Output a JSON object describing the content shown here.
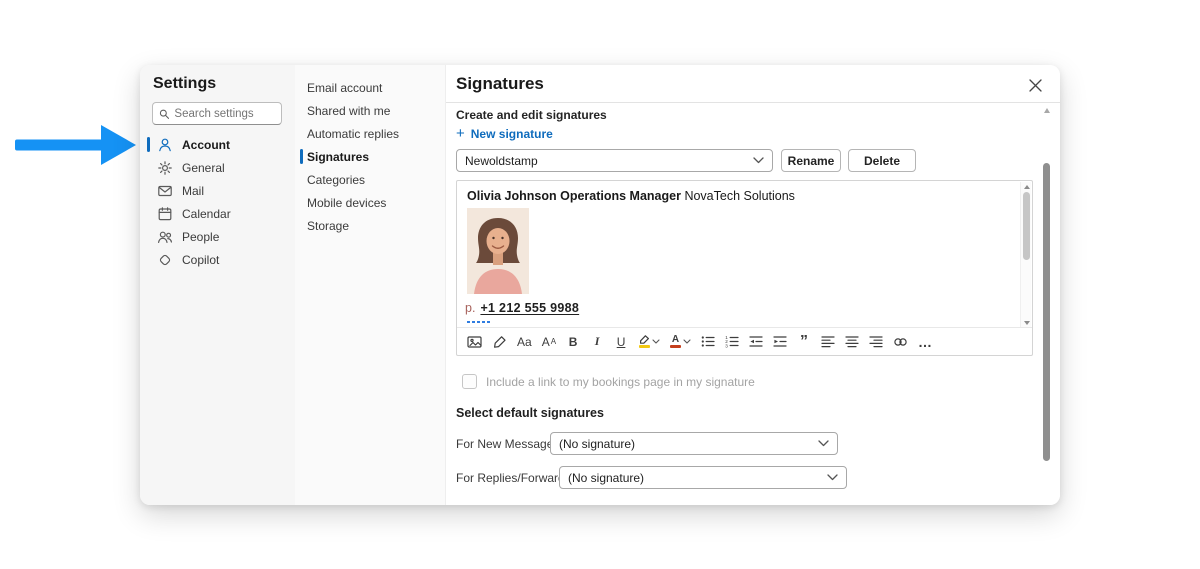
{
  "colors": {
    "accent": "#0f6cbd",
    "arrow": "#1592f4",
    "highlight": "#f2c811",
    "fontred": "#c43e1c"
  },
  "dialog": {
    "sidebar": {
      "title": "Settings",
      "search_placeholder": "Search settings",
      "items": [
        "Account",
        "General",
        "Mail",
        "Calendar",
        "People",
        "Copilot"
      ],
      "selected": "Account"
    },
    "subnav": {
      "items": [
        "Email account",
        "Shared with me",
        "Automatic replies",
        "Signatures",
        "Categories",
        "Mobile devices",
        "Storage"
      ],
      "selected": "Signatures"
    },
    "main": {
      "title": "Signatures",
      "create_section_label": "Create and edit signatures",
      "new_signature_label": "New signature",
      "signature_dropdown_value": "Newoldstamp",
      "rename_label": "Rename",
      "delete_label": "Delete",
      "editor": {
        "name": "Olivia Johnson",
        "role": "Operations Manager",
        "company": "NovaTech Solutions",
        "phone_prefix": "p.",
        "phone_number": "+1 212 555 9988"
      },
      "bookings_label": "Include a link to my bookings page in my signature",
      "defaults_heading": "Select default signatures",
      "new_messages_label": "For New Messages:",
      "new_messages_value": "(No signature)",
      "replies_label": "For Replies/Forwards:",
      "replies_value": "(No signature)"
    }
  },
  "icons": {
    "plus": "+",
    "font_case": "Aa",
    "font_size_main": "A",
    "font_size_sup": "A",
    "bold": "B",
    "italic": "I",
    "underline": "U",
    "font_color": "A",
    "quote": "”",
    "more": "…"
  }
}
